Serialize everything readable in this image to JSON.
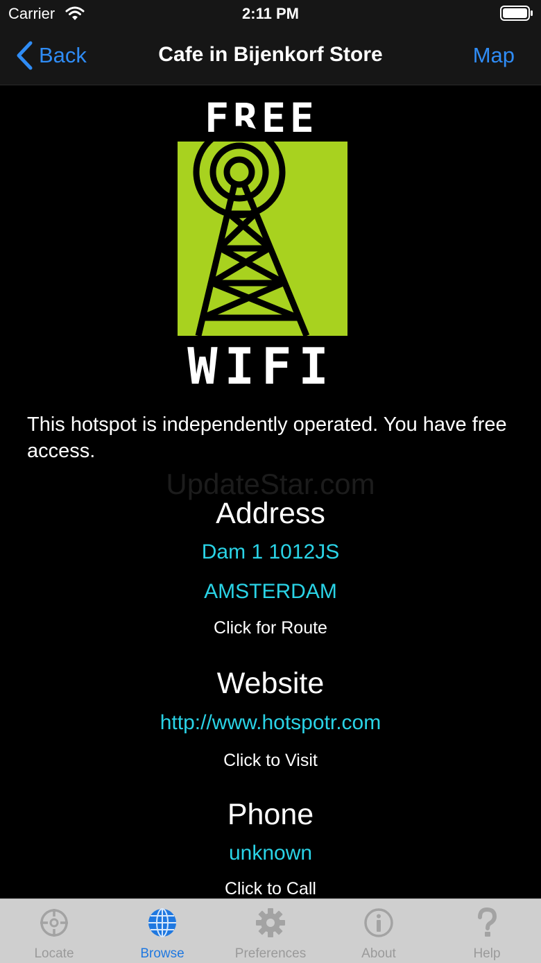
{
  "status_bar": {
    "carrier": "Carrier",
    "time": "2:11 PM",
    "icons": [
      "wifi-icon",
      "battery-icon"
    ]
  },
  "nav": {
    "back_label": "Back",
    "title": "Cafe in Bijenkorf Store",
    "map_label": "Map"
  },
  "logo": {
    "top_text": "FREE",
    "bottom_text": "WIFI",
    "accent_color": "#a8d21f"
  },
  "description": "This hotspot is independently operated. You have free access.",
  "watermark": "UpdateStar.com",
  "address": {
    "heading": "Address",
    "line1": "Dam 1 1012JS",
    "line2": "AMSTERDAM",
    "action": "Click for Route"
  },
  "website": {
    "heading": "Website",
    "url": "http://www.hotspotr.com",
    "action": "Click to Visit"
  },
  "phone": {
    "heading": "Phone",
    "number": "unknown",
    "action": "Click to Call"
  },
  "tabs": [
    {
      "label": "Locate",
      "icon": "crosshair-icon",
      "active": false
    },
    {
      "label": "Browse",
      "icon": "globe-icon",
      "active": true
    },
    {
      "label": "Preferences",
      "icon": "gear-icon",
      "active": false
    },
    {
      "label": "About",
      "icon": "info-icon",
      "active": false
    },
    {
      "label": "Help",
      "icon": "question-icon",
      "active": false
    }
  ],
  "colors": {
    "link": "#2ad3e6",
    "nav_blue": "#2f8cf5",
    "tab_active": "#1f78e0",
    "tab_inactive": "#9a9a9a"
  }
}
